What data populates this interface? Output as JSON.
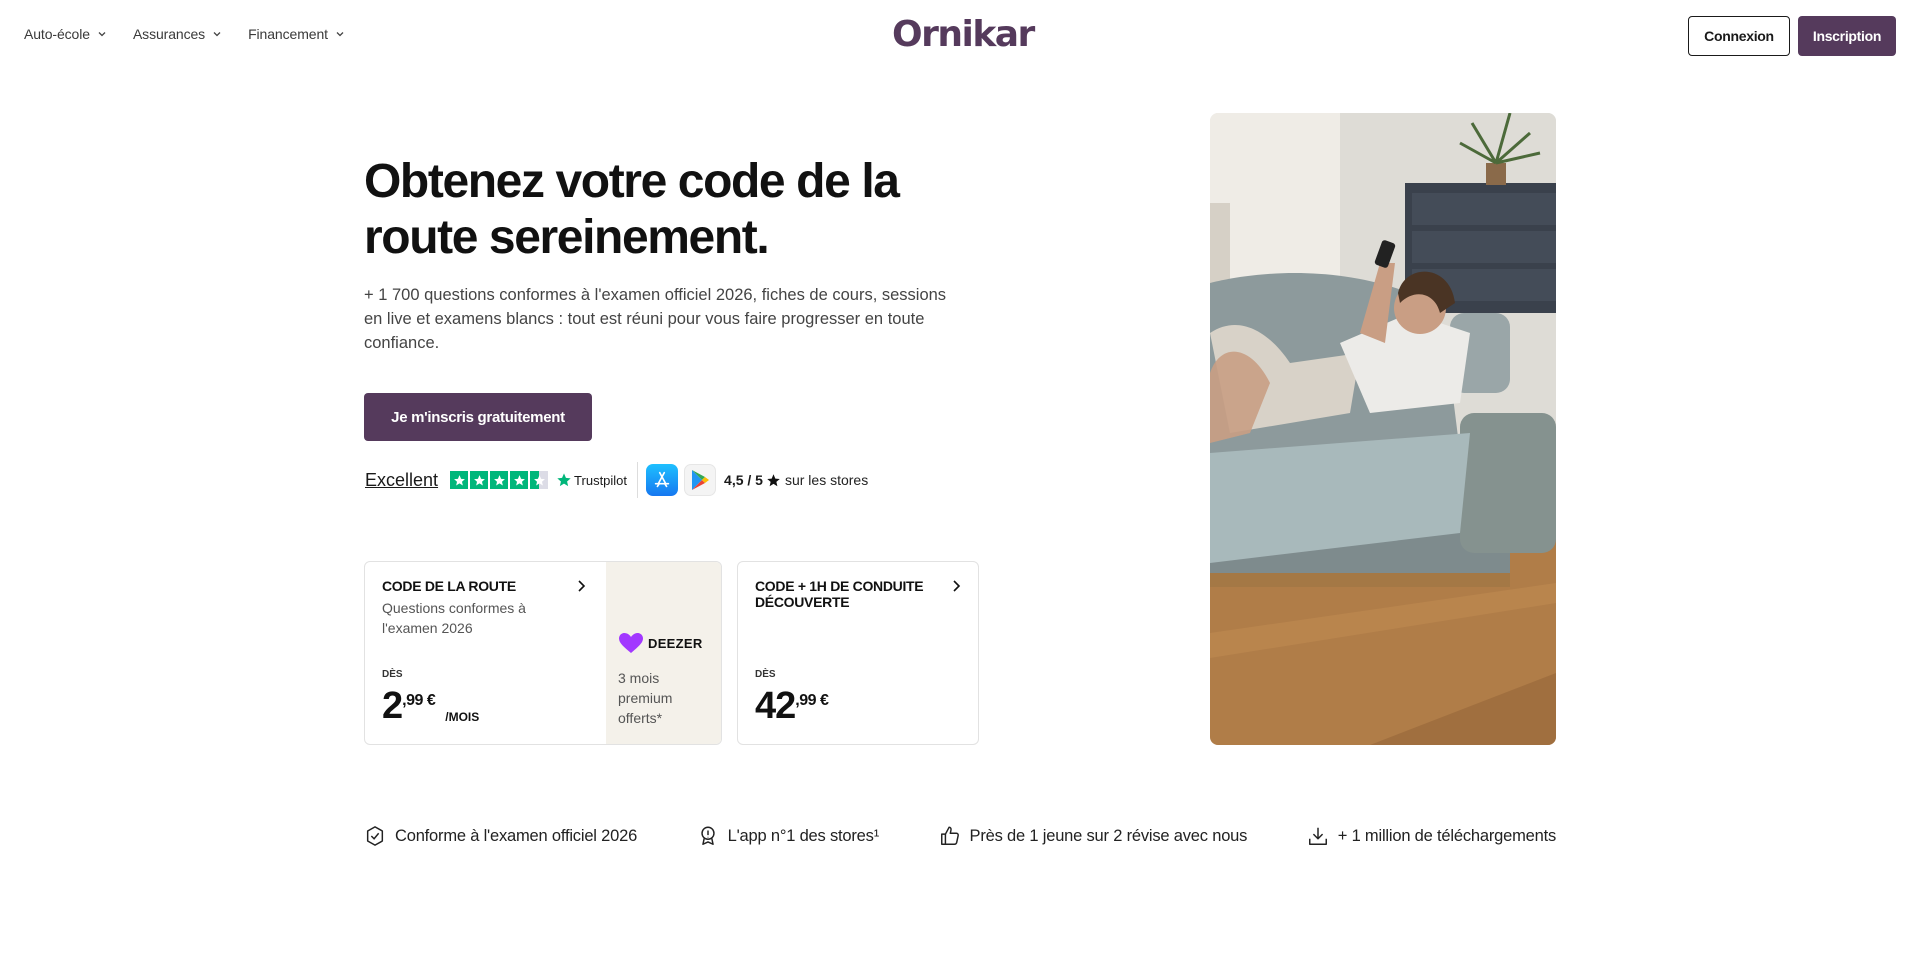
{
  "header": {
    "nav": [
      {
        "label": "Auto-école"
      },
      {
        "label": "Assurances"
      },
      {
        "label": "Financement"
      }
    ],
    "logo": "Ornikar",
    "login_label": "Connexion",
    "signup_label": "Inscription"
  },
  "hero": {
    "title": "Obtenez votre code de la route sereinement.",
    "description": "+ 1 700 questions conformes à l'examen officiel 2026, fiches de cours, sessions en live et examens blancs : tout est réuni pour vous faire progresser en toute confiance.",
    "cta_label": "Je m'inscris gratuitement"
  },
  "rating": {
    "trustpilot_label": "Excellent",
    "trustpilot_brand": "Trustpilot",
    "trustpilot_stars": 4.5,
    "store_score": "4,5 / 5",
    "store_text": "sur les stores"
  },
  "cards": [
    {
      "title": "CODE DE LA ROUTE",
      "subtitle": "Questions conformes à l'examen 2026",
      "from": "DÈS",
      "price_int": "2",
      "price_cents": ",99 €",
      "price_unit": "/MOIS",
      "promo_brand": "DEEZER",
      "promo_text": "3 mois premium offerts*"
    },
    {
      "title": "CODE + 1H DE CONDUITE DÉCOUVERTE",
      "from": "DÈS",
      "price_int": "42",
      "price_cents": ",99 €"
    }
  ],
  "features": [
    {
      "label": "Conforme à l'examen officiel 2026",
      "icon": "shield-check-icon"
    },
    {
      "label": "L'app n°1 des stores¹",
      "icon": "award-icon"
    },
    {
      "label": "Près de 1 jeune sur 2 révise avec nous",
      "icon": "thumbs-up-icon"
    },
    {
      "label": "+ 1 million de téléchargements",
      "icon": "download-icon"
    }
  ],
  "colors": {
    "brand": "#553a5c",
    "trustpilot": "#00b67a",
    "deezer_bg": "#f4f1ea"
  }
}
